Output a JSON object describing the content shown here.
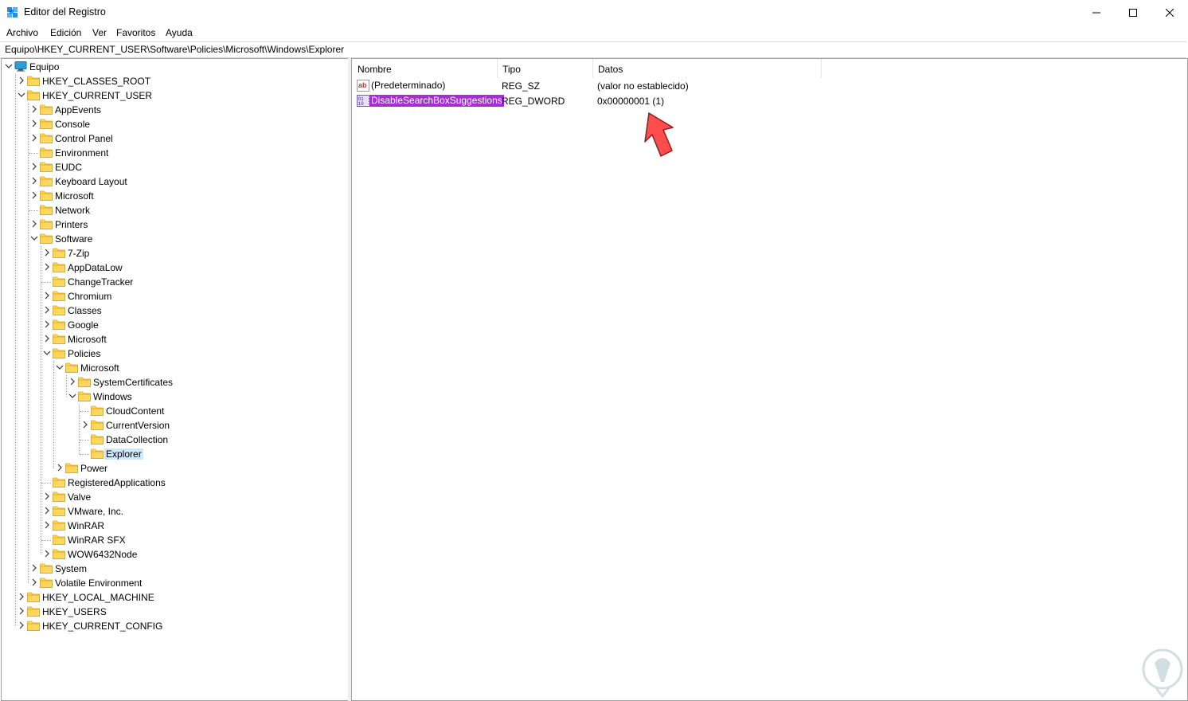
{
  "window": {
    "title": "Editor del Registro"
  },
  "menu": [
    "Archivo",
    "Edición",
    "Ver",
    "Favoritos",
    "Ayuda"
  ],
  "address": "Equipo\\HKEY_CURRENT_USER\\Software\\Policies\\Microsoft\\Windows\\Explorer",
  "tree": [
    {
      "label": "Equipo",
      "level": 0,
      "expand": "expanded",
      "icon": "computer-icon"
    },
    {
      "label": "HKEY_CLASSES_ROOT",
      "level": 1,
      "expand": "collapsed"
    },
    {
      "label": "HKEY_CURRENT_USER",
      "level": 1,
      "expand": "expanded"
    },
    {
      "label": "AppEvents",
      "level": 2,
      "expand": "collapsed"
    },
    {
      "label": "Console",
      "level": 2,
      "expand": "collapsed"
    },
    {
      "label": "Control Panel",
      "level": 2,
      "expand": "collapsed"
    },
    {
      "label": "Environment",
      "level": 2,
      "expand": "none"
    },
    {
      "label": "EUDC",
      "level": 2,
      "expand": "collapsed"
    },
    {
      "label": "Keyboard Layout",
      "level": 2,
      "expand": "collapsed"
    },
    {
      "label": "Microsoft",
      "level": 2,
      "expand": "collapsed"
    },
    {
      "label": "Network",
      "level": 2,
      "expand": "none"
    },
    {
      "label": "Printers",
      "level": 2,
      "expand": "collapsed"
    },
    {
      "label": "Software",
      "level": 2,
      "expand": "expanded"
    },
    {
      "label": "7-Zip",
      "level": 3,
      "expand": "collapsed"
    },
    {
      "label": "AppDataLow",
      "level": 3,
      "expand": "collapsed"
    },
    {
      "label": "ChangeTracker",
      "level": 3,
      "expand": "none"
    },
    {
      "label": "Chromium",
      "level": 3,
      "expand": "collapsed"
    },
    {
      "label": "Classes",
      "level": 3,
      "expand": "collapsed"
    },
    {
      "label": "Google",
      "level": 3,
      "expand": "collapsed"
    },
    {
      "label": "Microsoft",
      "level": 3,
      "expand": "collapsed"
    },
    {
      "label": "Policies",
      "level": 3,
      "expand": "expanded"
    },
    {
      "label": "Microsoft",
      "level": 4,
      "expand": "expanded"
    },
    {
      "label": "SystemCertificates",
      "level": 5,
      "expand": "collapsed"
    },
    {
      "label": "Windows",
      "level": 5,
      "expand": "expanded"
    },
    {
      "label": "CloudContent",
      "level": 6,
      "expand": "none"
    },
    {
      "label": "CurrentVersion",
      "level": 6,
      "expand": "collapsed"
    },
    {
      "label": "DataCollection",
      "level": 6,
      "expand": "none"
    },
    {
      "label": "Explorer",
      "level": 6,
      "expand": "none",
      "selected": true
    },
    {
      "label": "Power",
      "level": 4,
      "expand": "collapsed"
    },
    {
      "label": "RegisteredApplications",
      "level": 3,
      "expand": "none"
    },
    {
      "label": "Valve",
      "level": 3,
      "expand": "collapsed"
    },
    {
      "label": "VMware, Inc.",
      "level": 3,
      "expand": "collapsed"
    },
    {
      "label": "WinRAR",
      "level": 3,
      "expand": "collapsed"
    },
    {
      "label": "WinRAR SFX",
      "level": 3,
      "expand": "none"
    },
    {
      "label": "WOW6432Node",
      "level": 3,
      "expand": "collapsed"
    },
    {
      "label": "System",
      "level": 2,
      "expand": "collapsed"
    },
    {
      "label": "Volatile Environment",
      "level": 2,
      "expand": "collapsed"
    },
    {
      "label": "HKEY_LOCAL_MACHINE",
      "level": 1,
      "expand": "collapsed"
    },
    {
      "label": "HKEY_USERS",
      "level": 1,
      "expand": "collapsed"
    },
    {
      "label": "HKEY_CURRENT_CONFIG",
      "level": 1,
      "expand": "collapsed"
    }
  ],
  "columns": [
    "Nombre",
    "Tipo",
    "Datos"
  ],
  "values": [
    {
      "name": "(Predeterminado)",
      "type": "REG_SZ",
      "data": "(valor no establecido)",
      "icon": "string-value-icon"
    },
    {
      "name": "DisableSearchBoxSuggestions",
      "type": "REG_DWORD",
      "data": "0x00000001 (1)",
      "icon": "binary-value-icon",
      "selected": true
    }
  ],
  "colors": {
    "selection_accent": "#a52fd1",
    "tree_selection": "#cce8ff",
    "arrow": "#ff4d4d",
    "folder": "#ffd75e"
  }
}
